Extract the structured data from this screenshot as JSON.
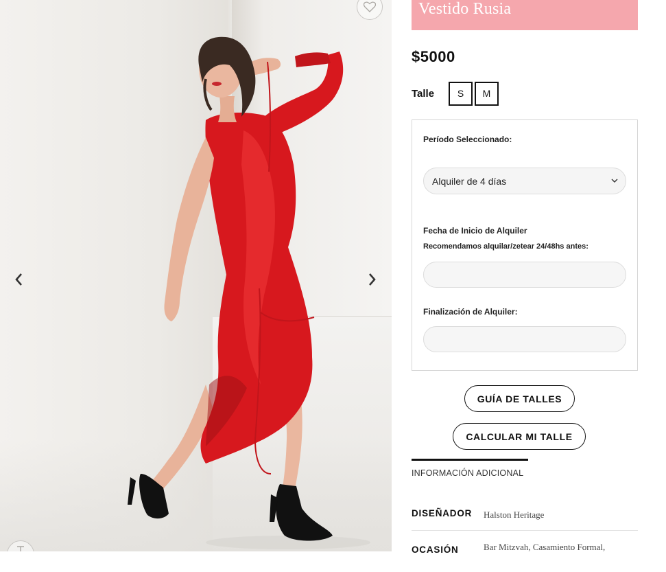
{
  "gallery": {
    "image_alt": "Modelo con vestido rojo de satín",
    "wishlist_icon": "heart-icon",
    "prev_icon": "chevron-left-icon",
    "next_icon": "chevron-right-icon",
    "zoom_icon": "expand-icon"
  },
  "product": {
    "title": "Vestido Rusia",
    "price": "$5000",
    "size_label": "Talle",
    "sizes": [
      "S",
      "M"
    ],
    "title_bg": "#f5a7ad"
  },
  "rental": {
    "period_label": "Período Seleccionado:",
    "period_value": "Alquiler de 4 días",
    "start_label": "Fecha de Inicio de Alquiler",
    "start_hint": "Recomendamos alquilar/zetear 24/48hs antes:",
    "start_value": "",
    "end_label": "Finalización de Alquiler:",
    "end_value": ""
  },
  "actions": {
    "size_guide": "GUÍA DE TALLES",
    "calc_size": "CALCULAR MI TALLE"
  },
  "tabs": {
    "info": "INFORMACIÓN ADICIONAL"
  },
  "attributes": [
    {
      "key": "DISEÑADOR",
      "value": "Halston Heritage"
    },
    {
      "key": "OCASIÓN",
      "value": "Bar Mitzvah, Casamiento Formal,"
    }
  ]
}
